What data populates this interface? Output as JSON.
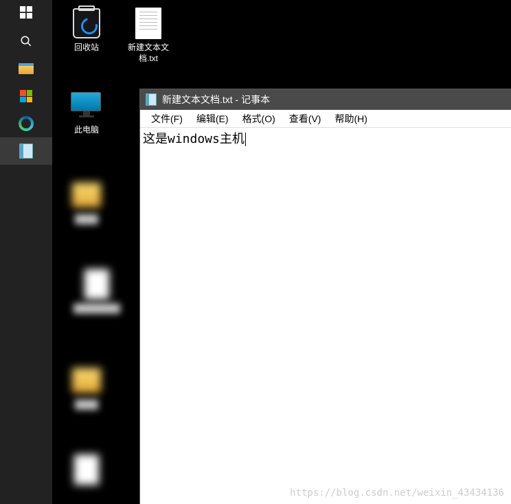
{
  "taskbar": {
    "items": [
      {
        "name": "start-button",
        "icon": "windows"
      },
      {
        "name": "search-button",
        "icon": "search"
      },
      {
        "name": "file-explorer",
        "icon": "explorer"
      },
      {
        "name": "microsoft-store",
        "icon": "store"
      },
      {
        "name": "edge-browser",
        "icon": "edge"
      },
      {
        "name": "notepad-task",
        "icon": "notepad",
        "active": true
      }
    ]
  },
  "desktop": {
    "icons": [
      {
        "name": "recycle-bin",
        "label": "回收站"
      },
      {
        "name": "text-file",
        "label": "新建文本文档.txt"
      },
      {
        "name": "this-pc",
        "label": "此电脑"
      },
      {
        "name": "folder-1",
        "label": "████",
        "blurred": true
      },
      {
        "name": "file-1",
        "label": "████████",
        "blurred": true
      },
      {
        "name": "folder-2",
        "label": "████",
        "blurred": true
      },
      {
        "name": "file-2",
        "label": "████",
        "blurred": true
      }
    ]
  },
  "notepad": {
    "title": "新建文本文档.txt - 记事本",
    "menu": {
      "file": "文件(F)",
      "edit": "编辑(E)",
      "format": "格式(O)",
      "view": "查看(V)",
      "help": "帮助(H)"
    },
    "content": "这是windows主机"
  },
  "watermark": "https://blog.csdn.net/weixin_43434136"
}
